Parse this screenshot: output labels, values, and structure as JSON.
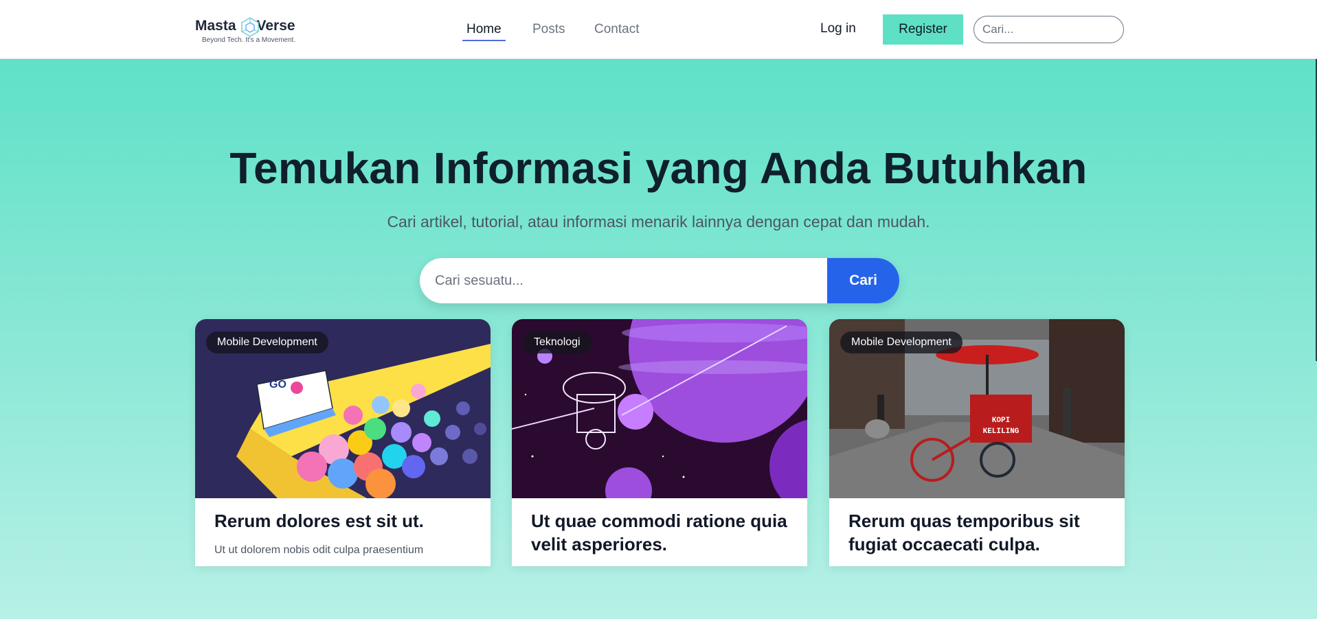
{
  "brand": {
    "name_left": "Masta",
    "name_right": "Verse",
    "tagline": "Beyond Tech. It's a Movement."
  },
  "nav": {
    "links": [
      {
        "label": "Home",
        "active": true
      },
      {
        "label": "Posts",
        "active": false
      },
      {
        "label": "Contact",
        "active": false
      }
    ],
    "login": "Log in",
    "register": "Register",
    "search_placeholder": "Cari..."
  },
  "hero": {
    "title": "Temukan Informasi yang Anda Butuhkan",
    "subtitle": "Cari artikel, tutorial, atau informasi menarik lainnya dengan cepat dan mudah.",
    "search_placeholder": "Cari sesuatu...",
    "search_button": "Cari"
  },
  "posts": [
    {
      "category": "Mobile Development",
      "title": "Rerum dolores est sit ut.",
      "excerpt": "Ut ut dolorem nobis odit culpa praesentium",
      "image_icon": "gopher-conference-illustration"
    },
    {
      "category": "Teknologi",
      "title": "Ut quae commodi ratione quia velit asperiores.",
      "excerpt": "",
      "image_icon": "space-probe-planets-illustration"
    },
    {
      "category": "Mobile Development",
      "title": "Rerum quas temporibus sit fugiat occaecati culpa.",
      "excerpt": "",
      "image_icon": "coffee-bike-cart-photo",
      "image_text": "KOPI KELILING"
    }
  ],
  "colors": {
    "accent": "#5ee0c5",
    "primary": "#2563eb",
    "dark": "#0f1f2b"
  }
}
